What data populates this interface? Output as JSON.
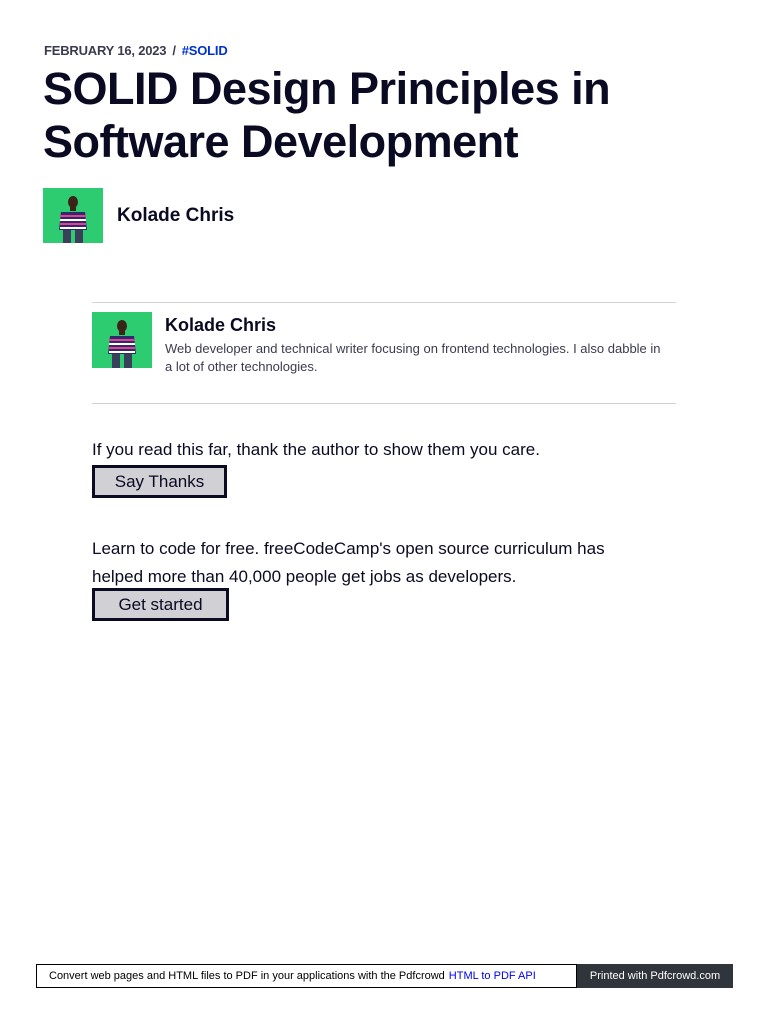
{
  "article": {
    "date": "FEBRUARY 16, 2023",
    "separator": "/",
    "tag": "#SOLID",
    "title": "SOLID Design Principles in Software Development",
    "author_name": "Kolade Chris"
  },
  "bio": {
    "name": "Kolade Chris",
    "text": "Web developer and technical writer focusing on frontend technologies. I also dabble in a lot of other technologies."
  },
  "thanks": {
    "text": "If you read this far, thank the author to show them you care.",
    "button_label": "Say Thanks"
  },
  "learn": {
    "text": "Learn to code for free. freeCodeCamp's open source curriculum has helped more than 40,000 people get jobs as developers.",
    "button_label": "Get started"
  },
  "footer": {
    "left_text": "Convert web pages and HTML files to PDF in your applications with the Pdfcrowd",
    "link_text": "HTML to PDF API",
    "right_text": "Printed with Pdfcrowd.com"
  },
  "colors": {
    "avatar_bg": "#2ecc71",
    "tag_link": "#0033cc",
    "button_bg": "#d0d0d5",
    "text_dark": "#0a0a23"
  },
  "icons": {
    "author_avatar": "person-avatar-icon"
  }
}
